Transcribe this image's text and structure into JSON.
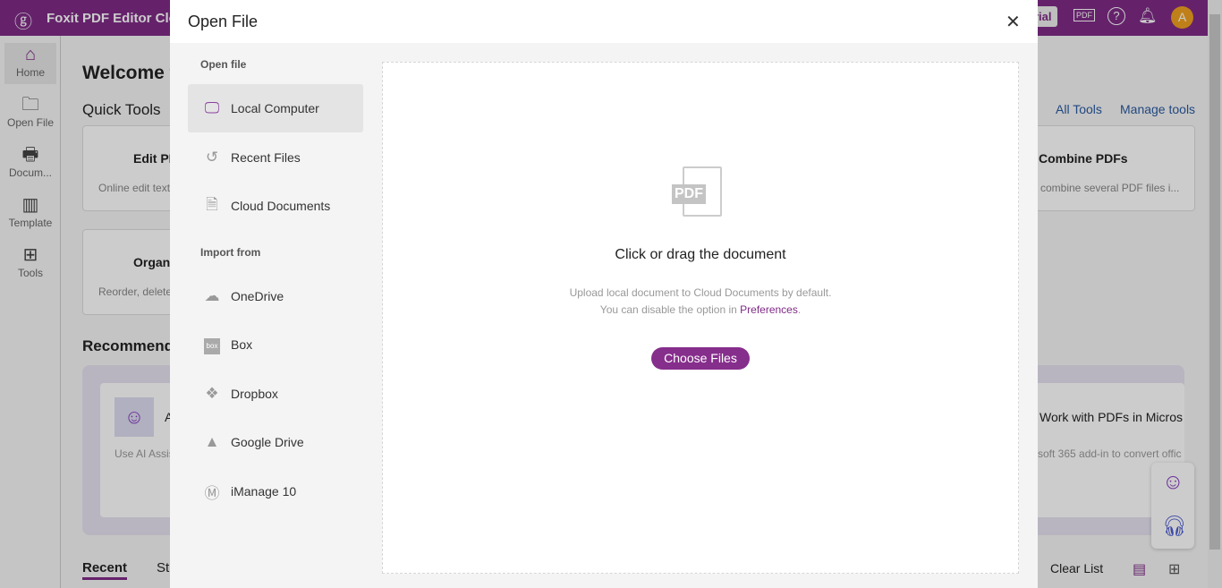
{
  "app": {
    "title": "Foxit PDF Editor Cloud",
    "trial_label": "rial",
    "avatar": "A",
    "accent": "#7f2b86"
  },
  "sidebar": {
    "items": [
      {
        "label": "Home",
        "icon": "home-icon"
      },
      {
        "label": "Open File",
        "icon": "folder-icon"
      },
      {
        "label": "Docum...",
        "icon": "document-icon"
      },
      {
        "label": "Template",
        "icon": "template-icon"
      },
      {
        "label": "Tools",
        "icon": "tools-icon"
      }
    ]
  },
  "main": {
    "welcome": "Welcome t",
    "quick_tools": "Quick Tools",
    "all_tools": "All Tools",
    "manage_tools": "Manage tools",
    "tools": [
      {
        "title": "Edit PD",
        "desc": "Online edit text"
      },
      {
        "title": "Organi",
        "desc": "Reorder, delete"
      },
      {
        "title": "Combine PDFs",
        "desc": "combine several PDF files i..."
      }
    ],
    "recommended": "Recommende",
    "rec_cards": [
      {
        "title": "A",
        "desc": "Use AI Assis"
      },
      {
        "title": "Work with PDFs in Micros",
        "desc": "soft 365 add-in to convert offic"
      }
    ],
    "tabs": [
      "Recent",
      "St"
    ],
    "clear_list": "Clear List"
  },
  "modal": {
    "title": "Open File",
    "section_open": "Open file",
    "section_import": "Import from",
    "open_items": [
      {
        "label": "Local Computer",
        "icon": "monitor-icon"
      },
      {
        "label": "Recent Files",
        "icon": "history-icon"
      },
      {
        "label": "Cloud Documents",
        "icon": "document-icon"
      }
    ],
    "import_items": [
      {
        "label": "OneDrive",
        "icon": "onedrive-icon"
      },
      {
        "label": "Box",
        "icon": "box-icon"
      },
      {
        "label": "Dropbox",
        "icon": "dropbox-icon"
      },
      {
        "label": "Google Drive",
        "icon": "google-drive-icon"
      },
      {
        "label": "iManage 10",
        "icon": "imanage-icon"
      }
    ],
    "drop_title": "Click or drag the document",
    "drop_line1": "Upload local document to Cloud Documents by default.",
    "drop_line2_prefix": "You can disable the option in ",
    "drop_link": "Preferences",
    "drop_line2_suffix": ".",
    "choose_files": "Choose Files",
    "pdf_icon_text": "PDF"
  }
}
